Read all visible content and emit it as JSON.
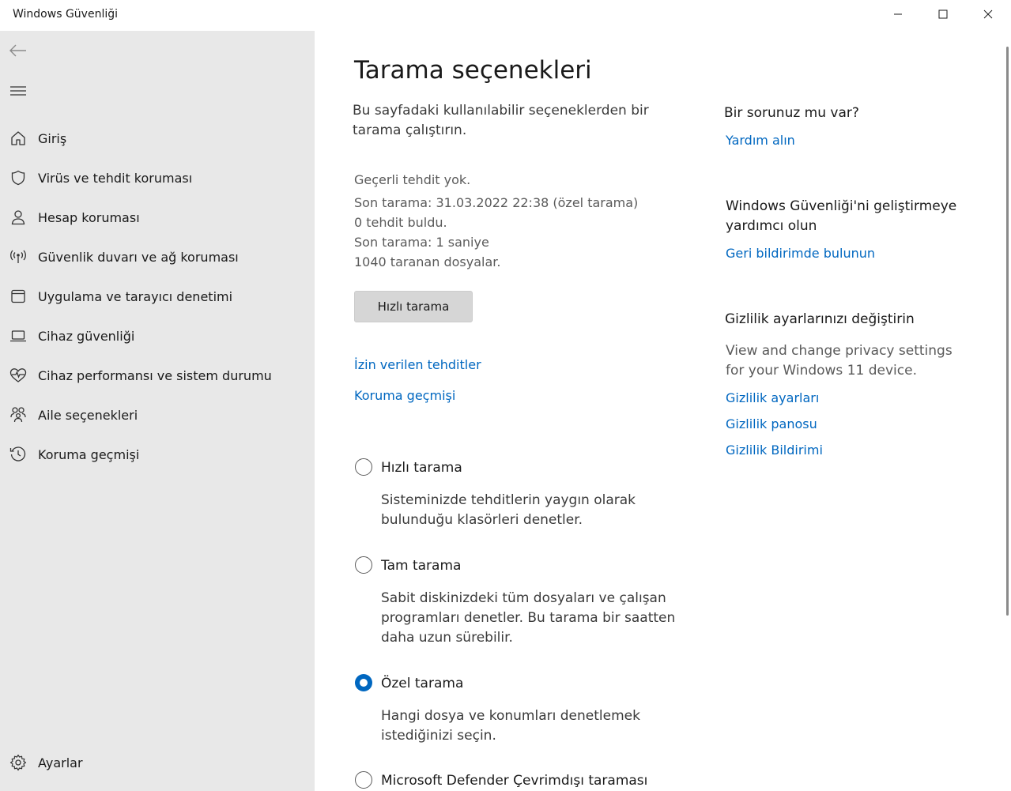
{
  "window": {
    "title": "Windows Güvenliği"
  },
  "sidebar": {
    "items": [
      {
        "label": "Giriş",
        "icon": "home-icon"
      },
      {
        "label": "Virüs ve tehdit koruması",
        "icon": "shield-icon"
      },
      {
        "label": "Hesap koruması",
        "icon": "person-icon"
      },
      {
        "label": "Güvenlik duvarı ve ağ koruması",
        "icon": "antenna-icon"
      },
      {
        "label": "Uygulama ve tarayıcı denetimi",
        "icon": "app-window-icon"
      },
      {
        "label": "Cihaz güvenliği",
        "icon": "laptop-icon"
      },
      {
        "label": "Cihaz performansı ve sistem durumu",
        "icon": "heart-pulse-icon"
      },
      {
        "label": "Aile seçenekleri",
        "icon": "family-icon"
      },
      {
        "label": "Koruma geçmişi",
        "icon": "history-icon"
      }
    ],
    "settings": {
      "label": "Ayarlar",
      "icon": "gear-icon"
    }
  },
  "main": {
    "title": "Tarama seçenekleri",
    "description": [
      "Bu sayfadaki kullanılabilir seçeneklerden bir",
      "tarama çalıştırın."
    ],
    "status": [
      "Geçerli tehdit yok.",
      "Son tarama: 31.03.2022 22:38 (özel tarama)",
      "0 tehdit buldu.",
      "Son tarama: 1 saniye",
      "1040 taranan dosyalar."
    ],
    "scan_button": "Hızlı tarama",
    "links": {
      "allowed": "İzin verilen tehditler",
      "history": "Koruma geçmişi"
    },
    "options": [
      {
        "label": "Hızlı tarama",
        "checked": false,
        "desc": [
          "Sisteminizde tehditlerin yaygın olarak",
          "bulunduğu klasörleri denetler."
        ]
      },
      {
        "label": "Tam tarama",
        "checked": false,
        "desc": [
          "Sabit diskinizdeki tüm dosyaları ve çalışan",
          "programları denetler. Bu tarama bir saatten",
          "daha uzun sürebilir."
        ]
      },
      {
        "label": "Özel tarama",
        "checked": true,
        "desc": [
          "Hangi dosya ve konumları denetlemek",
          "istediğinizi seçin."
        ]
      },
      {
        "label": "Microsoft Defender Çevrimdışı taraması",
        "checked": false,
        "desc": []
      }
    ]
  },
  "aside": {
    "question": {
      "heading": "Bir sorunuz mu var?",
      "link": "Yardım alın"
    },
    "improve": {
      "heading": [
        "Windows Güvenliği'ni geliştirmeye",
        "yardımcı olun"
      ],
      "link": "Geri bildirimde bulunun"
    },
    "privacy": {
      "heading": "Gizlilik ayarlarınızı değiştirin",
      "text": [
        "View and change privacy settings",
        "for your Windows 11 device."
      ],
      "links": [
        "Gizlilik ayarları",
        "Gizlilik panosu",
        "Gizlilik Bildirimi"
      ]
    }
  }
}
